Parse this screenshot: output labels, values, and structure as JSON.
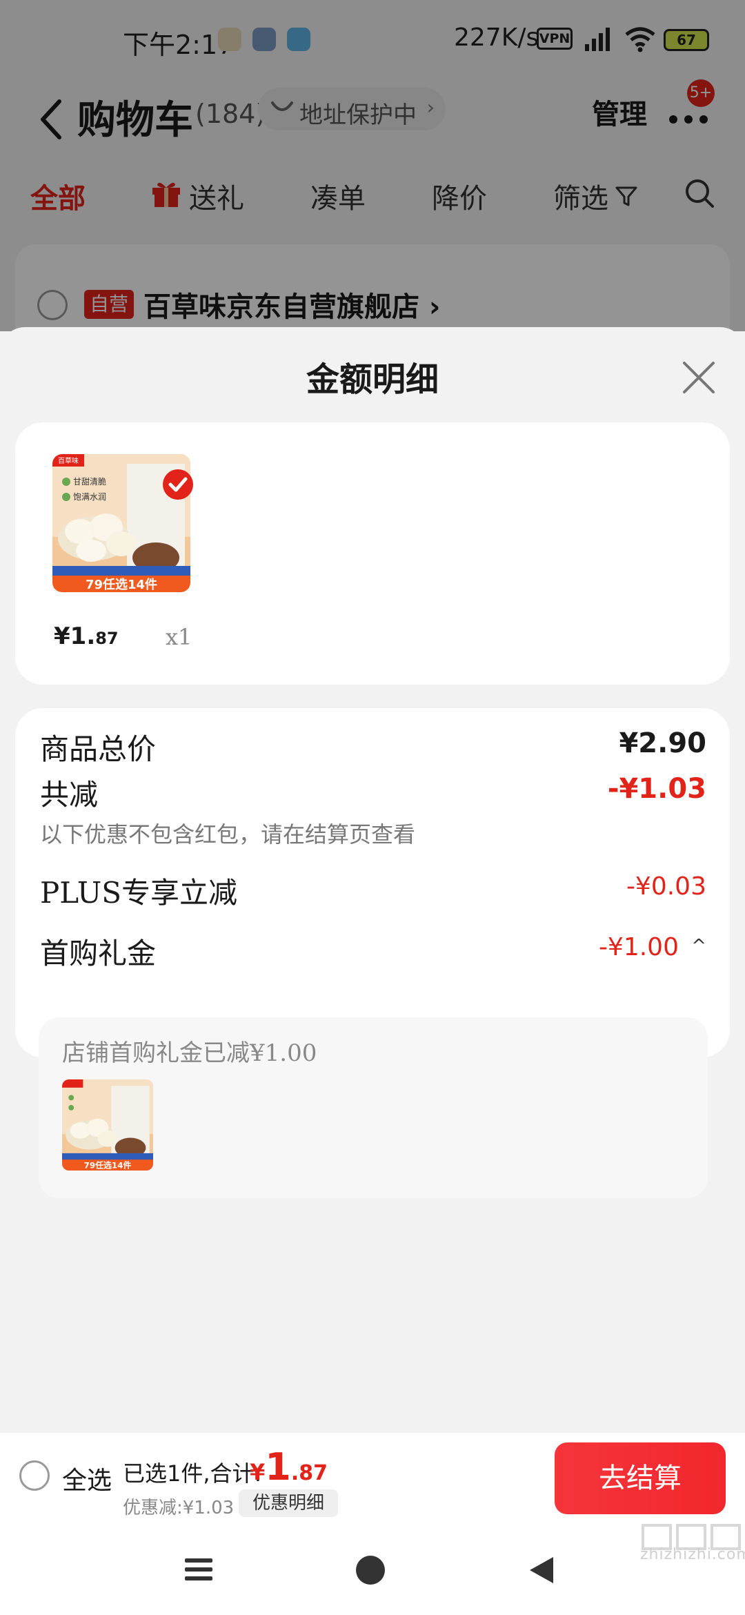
{
  "status_bar": {
    "time": "下午2:17",
    "net_speed": "227K/s",
    "vpn_label": "VPN",
    "battery": "67"
  },
  "nav": {
    "title": "购物车",
    "count": "(184)",
    "address_protect": "地址保护中",
    "address_chevron": "›",
    "manage": "管理",
    "more_badge": "5+"
  },
  "tabs": {
    "all": "全部",
    "gift": "送礼",
    "bundle": "凑单",
    "price_drop": "降价",
    "filter": "筛选"
  },
  "store": {
    "tag": "自营",
    "name": "百草味京东自营旗舰店 ›"
  },
  "sheet": {
    "title": "金额明细",
    "item": {
      "price_int": "¥1.",
      "price_dec": "87",
      "qty": "x1"
    },
    "summary": {
      "total_label": "商品总价",
      "total_value": "¥2.90",
      "reduce_label": "共减",
      "reduce_value": "-¥1.03",
      "reduce_note": "以下优惠不包含红包，请在结算页查看",
      "plus_label": "PLUS专享立减",
      "plus_value": "-¥0.03",
      "gift_label": "首购礼金",
      "gift_value": "-¥1.00",
      "gift_chevron": "^",
      "gift_note": "店铺首购礼金已减¥1.00"
    }
  },
  "product_art": {
    "brand": "百草味",
    "line1": "甘甜清脆",
    "line2": "饱满水润",
    "promo": "79任选14件"
  },
  "checkout": {
    "select_all": "全选",
    "selected_text": "已选1件,合计:",
    "total_symbol": "¥",
    "total_int": "1",
    "total_dec": ".87",
    "discount_text": "优惠减:¥1.03",
    "detail_button": "优惠明细",
    "pay_button": "去结算"
  },
  "watermark": {
    "text": "zhizhizhi.com"
  },
  "colors": {
    "accent_red": "#e2231a",
    "pay_button": "#f5353b",
    "sheet_bg": "#f2f2f2"
  }
}
